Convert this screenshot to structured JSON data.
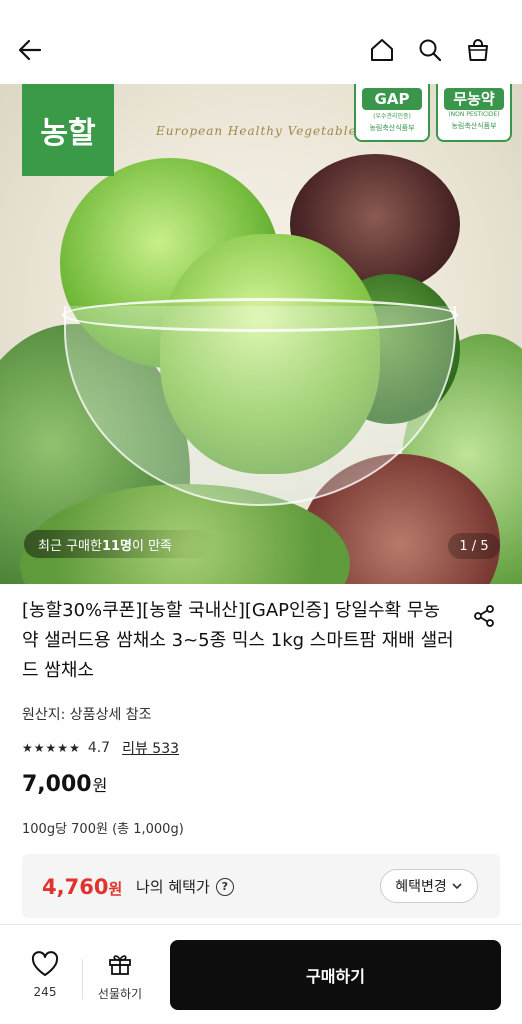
{
  "header": {
    "icons": {
      "back": "back-arrow-icon",
      "home": "home-icon",
      "search": "search-icon",
      "cart": "shopping-bag-icon"
    }
  },
  "hero": {
    "brand": "농할",
    "slogan": "European Healthy Vegetable",
    "badges": [
      {
        "main": "GAP",
        "sub": "(우수관리인증)",
        "org": "농림축산식품부"
      },
      {
        "main": "무농약",
        "sub": "(NON PESTICIDE)",
        "org": "농림축산식품부"
      }
    ],
    "review_prefix": "최근 구매한 ",
    "review_count": "11명",
    "review_suffix": "이 만족",
    "pager": "1 / 5"
  },
  "product": {
    "title": "[농할30%쿠폰][농할 국내산][GAP인증] 당일수확 무농약 샐러드용 쌈채소 3~5종 믹스 1kg 스마트팜 재배 샐러드 쌈채소",
    "origin": "원산지: 상품상세 참조",
    "rating": {
      "stars": 4.7,
      "score": "4.7",
      "reviews": "리뷰 533"
    },
    "price": "7,000",
    "price_unit": "원",
    "unit_price": "100g당 700원 (총 1,000g)"
  },
  "benefit": {
    "price": "4,760",
    "price_unit": "원",
    "label": "나의 혜택가",
    "change_button": "혜택변경"
  },
  "bottom": {
    "like_count": "245",
    "gift_label": "선물하기",
    "buy_label": "구매하기"
  },
  "colors": {
    "accent_red": "#e0322f",
    "brand_green": "#3a9a48",
    "buy_button": "#0d0d0d"
  }
}
